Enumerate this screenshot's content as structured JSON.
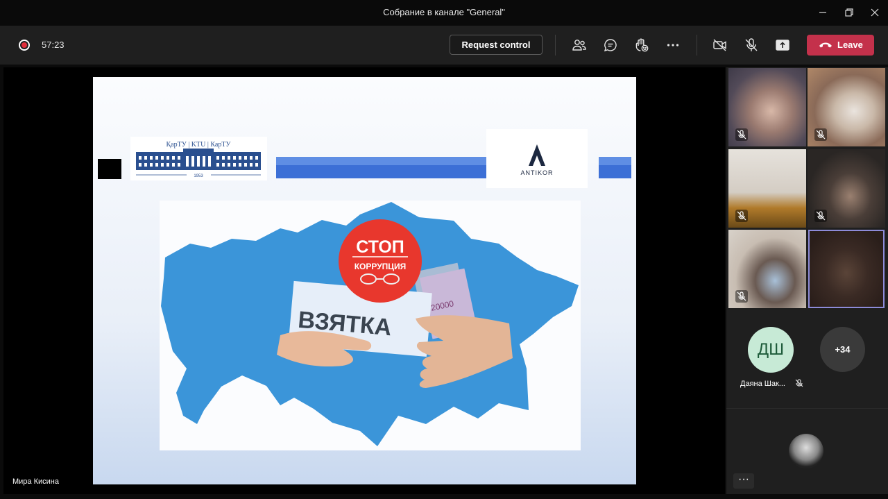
{
  "window": {
    "title": "Собрание в канале \"General\""
  },
  "toolbar": {
    "timer": "57:23",
    "request_control": "Request control",
    "leave": "Leave"
  },
  "slide": {
    "logo_ktu": "ҚарТУ | KTU | КарТУ",
    "logo_year": "1953",
    "logo_antikor": "ANTIKOR",
    "stop": "СТОП",
    "corruption": "КОРРУПЦИЯ",
    "bribe": "ВЗЯТКА",
    "banknote": "20000"
  },
  "presenter": {
    "name": "Мира Кисина"
  },
  "participants": {
    "avatar_initials": "ДШ",
    "avatar_name": "Даяна Шак...",
    "more_count": "+34"
  },
  "colors": {
    "leave": "#c4314b",
    "active_tile": "#8d8bd9",
    "map_blue": "#3b95d9",
    "stop_red": "#e8372d"
  }
}
